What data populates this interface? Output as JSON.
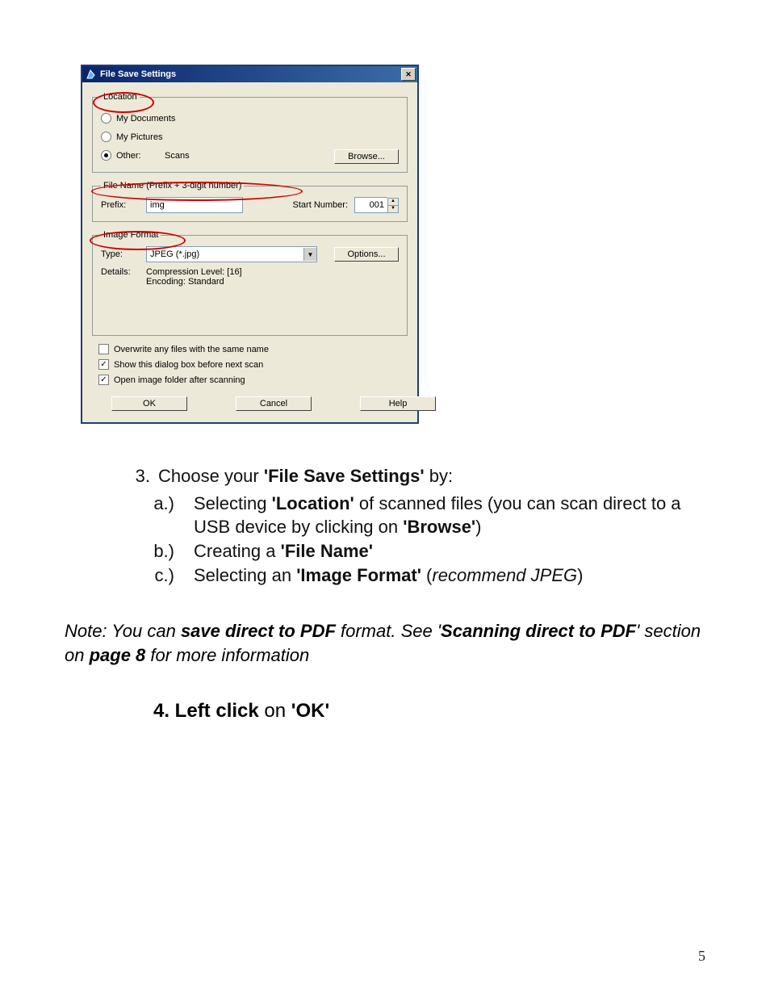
{
  "dialog": {
    "title": "File Save Settings",
    "location": {
      "legend": "Location",
      "my_documents": "My Documents",
      "my_pictures": "My Pictures",
      "other_label": "Other:",
      "other_value": "Scans",
      "browse": "Browse..."
    },
    "filename": {
      "legend": "File Name (Prefix + 3-digit number)",
      "prefix_label": "Prefix:",
      "prefix_value": "img",
      "start_label": "Start Number:",
      "start_value": "001"
    },
    "image_format": {
      "legend": "Image Format",
      "type_label": "Type:",
      "type_value": "JPEG (*.jpg)",
      "options": "Options...",
      "details_label": "Details:",
      "details_line1": "Compression Level: [16]",
      "details_line2": "Encoding: Standard"
    },
    "checks": {
      "overwrite": "Overwrite any files with the same name",
      "show_dialog": "Show this dialog box before next scan",
      "open_folder": "Open image folder after scanning"
    },
    "buttons": {
      "ok": "OK",
      "cancel": "Cancel",
      "help": "Help"
    }
  },
  "instructions": {
    "step3_num": "3.",
    "step3_lead": "Choose your ",
    "step3_bold": "'File Save Settings'",
    "step3_tail": " by:",
    "a_m": "a.)",
    "a_lead": "Selecting ",
    "a_b1": "'Location'",
    "a_mid": " of scanned files (you can scan direct to a USB device by clicking on ",
    "a_b2": "'Browse'",
    "a_tail": ")",
    "b_m": "b.)",
    "b_lead": "Creating a ",
    "b_b": "'File Name'",
    "c_m": "c.)",
    "c_lead": "Selecting an ",
    "c_b": "'Image Format'",
    "c_tail": " (",
    "c_ital": "recommend JPEG",
    "c_close": ")"
  },
  "note": {
    "lead": "Note: You can ",
    "b1": "save direct to PDF",
    "mid1": " format. See '",
    "b2": "Scanning direct to PDF",
    "mid2": "' section on ",
    "b3": "page 8",
    "tail": " for more information"
  },
  "step4": {
    "n": "4.",
    "a": " Left click",
    "on": " on ",
    "b": "'OK'"
  },
  "page_number": "5"
}
